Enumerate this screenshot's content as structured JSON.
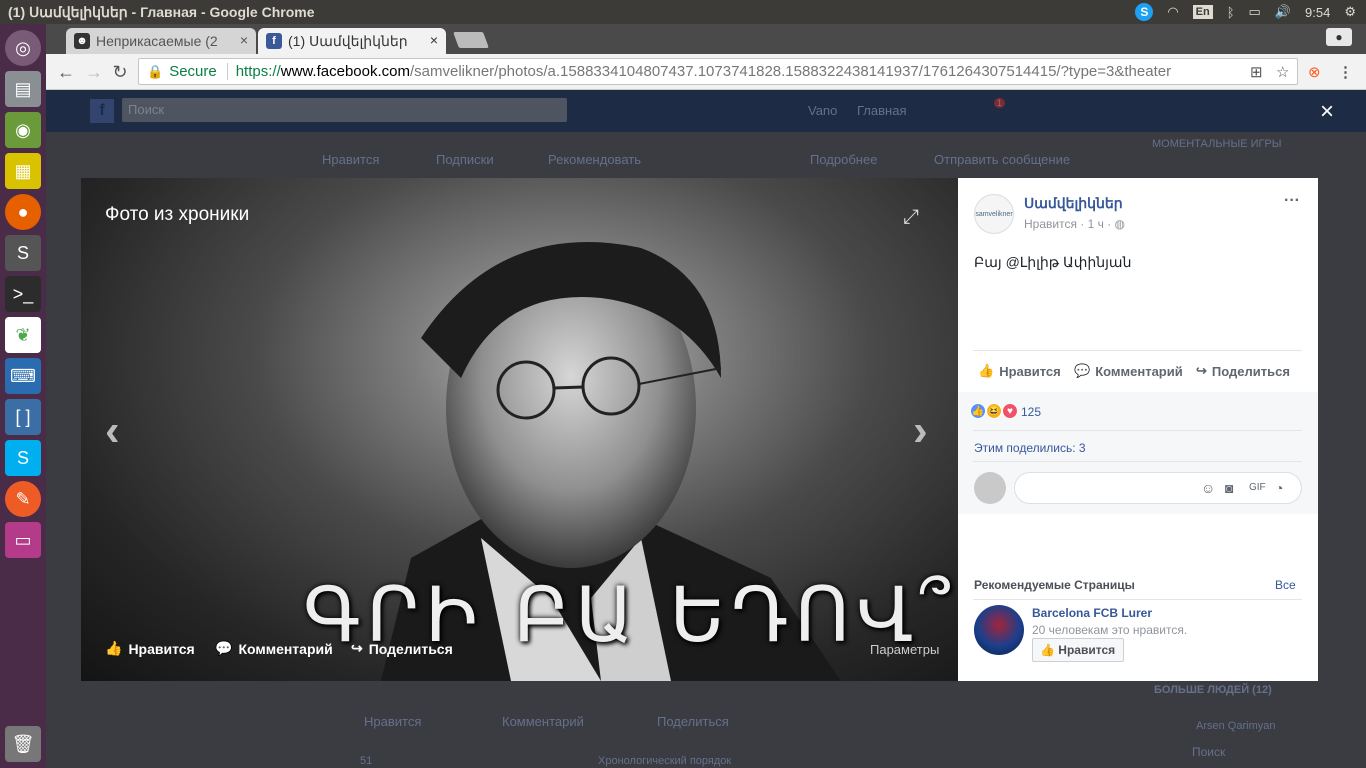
{
  "system": {
    "window_title": "(1) Սամվելիկներ - Главная - Google Chrome",
    "tray": {
      "lang": "En",
      "time": "9:54"
    }
  },
  "launcher": {
    "apps": [
      "ubuntu-home-icon",
      "files-icon",
      "chrome-icon",
      "notes-icon",
      "firefox-icon",
      "sublime-icon",
      "terminal-icon",
      "mongodb-icon",
      "vscode-icon",
      "bracket-app-icon",
      "skype-icon",
      "postman-icon",
      "window-app-icon",
      "trash-icon"
    ]
  },
  "browser": {
    "tabs": [
      {
        "title": "Неприкасаемые (2",
        "close": "×"
      },
      {
        "title": "(1) Սամվելիկներ",
        "close": "×"
      }
    ],
    "url": {
      "lock": "🔒",
      "secure": "Secure",
      "proto": "https://",
      "host": "www.facebook.com",
      "path": "/samvelikner/photos/a.1588334104807437.1073741828.1588322438141937/1761264307514415/?type=3&theater"
    }
  },
  "fb_bg": {
    "search": "Поиск",
    "user": "Vano",
    "home": "Главная",
    "notif_count": "1",
    "likes_btn": "Нравится",
    "subs_btn": "Подписки",
    "recommend_btn": "Рекомендовать",
    "more_btn": "Подробнее",
    "message_btn": "Отправить сообщение",
    "games": "МОМЕНТАЛЬНЫЕ ИГРЫ",
    "bg_like": "Нравится",
    "bg_comment": "Комментарий",
    "bg_share": "Поделиться",
    "bg_count": "51",
    "bg_order": "Хронологический порядок",
    "more_people": "БОЛЬШЕ ЛЮДЕЙ (12)",
    "person": "Arsen Qarimyan",
    "chat_search": "Поиск"
  },
  "viewer": {
    "photo_title": "Фото из хроники",
    "caption": "ԳՐԻ ԲԱ ԵԴՈՎ՞",
    "like": "Нравится",
    "comment": "Комментарий",
    "share": "Поделиться",
    "params": "Параметры",
    "close": "×"
  },
  "post": {
    "page_name": "Սամվելիկներ",
    "avatar_text": "samvelikner",
    "meta": "Нравится · 1 ч · ",
    "text": "Բայ @Լիլիթ Ափինյան",
    "like": "Нравится",
    "comment": "Комментарий",
    "share": "Поделиться",
    "reactions_count": "125",
    "shared": "Этим поделились: 3"
  },
  "recommended": {
    "title": "Рекомендуемые Страницы",
    "all": "Все",
    "page_name": "Barcelona FCB Lurer",
    "page_meta": "20 человекам это нравится.",
    "like": "Нравится"
  },
  "colors": {
    "fb_blue": "#365899",
    "launcher": "#4b2c48"
  }
}
